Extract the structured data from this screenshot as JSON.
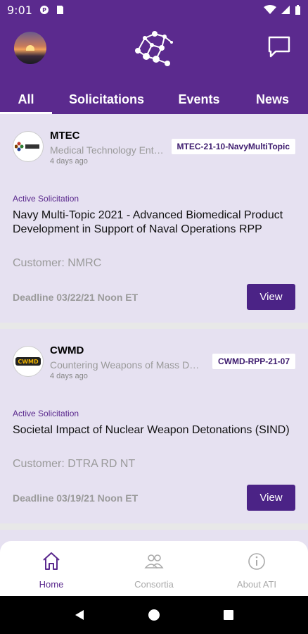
{
  "status_bar": {
    "time": "9:01"
  },
  "header": {
    "avatar_alt": "profile",
    "logo_icon": "network-logo-icon",
    "chat_icon": "chat-icon"
  },
  "tabs": [
    {
      "label": "All",
      "active": true
    },
    {
      "label": "Solicitations",
      "active": false
    },
    {
      "label": "Events",
      "active": false
    },
    {
      "label": "News",
      "active": false
    }
  ],
  "feed": [
    {
      "org_name": "MTEC",
      "org_full": "Medical Technology Enterprise Consortium",
      "posted": "4 days ago",
      "code": "MTEC-21-10-NavyMultiTopic",
      "status": "Active Solicitation",
      "title": "Navy Multi-Topic 2021 - Advanced Biomedical Product Development in Support of Naval Operations RPP",
      "customer": "Customer: NMRC",
      "deadline": "Deadline 03/22/21 Noon ET",
      "action": "View"
    },
    {
      "org_name": "CWMD",
      "org_full": "Countering Weapons of Mass Destruction",
      "posted": "4 days ago",
      "code": "CWMD-RPP-21-07",
      "status": "Active Solicitation",
      "title": "Societal Impact of Nuclear Weapon Detonations (SIND)",
      "customer": "Customer: DTRA RD NT",
      "deadline": "Deadline 03/19/21 Noon ET",
      "action": "View"
    }
  ],
  "bottom_nav": [
    {
      "label": "Home",
      "icon": "home-icon",
      "active": true
    },
    {
      "label": "Consortia",
      "icon": "people-icon",
      "active": false
    },
    {
      "label": "About ATI",
      "icon": "info-icon",
      "active": false
    }
  ],
  "colors": {
    "primary": "#5b2a8e",
    "card_bg": "#e6e1f1",
    "button": "#4b2386"
  }
}
